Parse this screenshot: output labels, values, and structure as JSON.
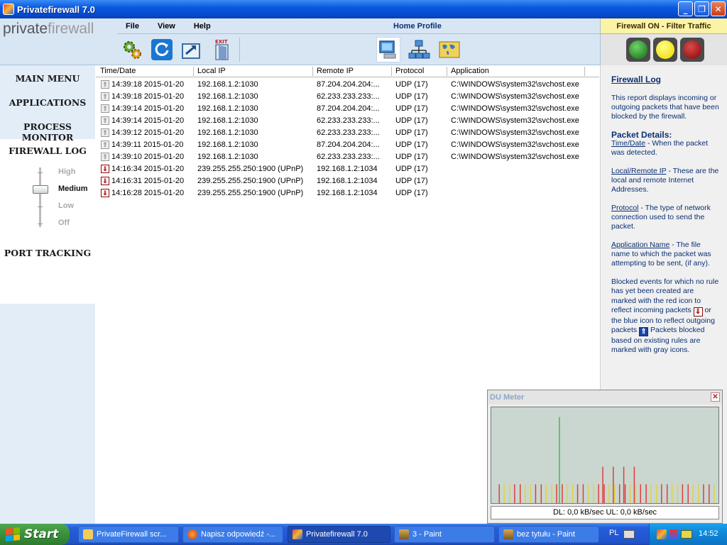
{
  "window": {
    "title": "Privatefirewall 7.0",
    "minimize": "_",
    "maximize": "❐",
    "close": "✕"
  },
  "logo": {
    "part1": "private",
    "part2": "firewall"
  },
  "menu": [
    "File",
    "View",
    "Help"
  ],
  "profile": "Home Profile",
  "status": {
    "label": "Firewall ON - Filter Traffic",
    "colors": {
      "green": "#2c8a2a",
      "yellow": "#f4e51b",
      "red": "#a01818"
    }
  },
  "sidebar": {
    "items": [
      "MAIN MENU",
      "APPLICATIONS",
      "PROCESS MONITOR",
      "FIREWALL LOG",
      "PORT TRACKING"
    ],
    "levels": [
      "High",
      "Medium",
      "Low",
      "Off"
    ],
    "selected_level": "Medium"
  },
  "log": {
    "columns": [
      "Time/Date",
      "Local IP",
      "Remote IP",
      "Protocol",
      "Application"
    ],
    "rows": [
      {
        "type": "gray",
        "time": "14:39:18  2015-01-20",
        "local": "192.168.1.2:1030",
        "remote": "87.204.204.204:...",
        "protocol": "UDP (17)",
        "app": "C:\\WINDOWS\\system32\\svchost.exe"
      },
      {
        "type": "gray",
        "time": "14:39:18  2015-01-20",
        "local": "192.168.1.2:1030",
        "remote": "62.233.233.233:...",
        "protocol": "UDP (17)",
        "app": "C:\\WINDOWS\\system32\\svchost.exe"
      },
      {
        "type": "gray",
        "time": "14:39:14  2015-01-20",
        "local": "192.168.1.2:1030",
        "remote": "87.204.204.204:...",
        "protocol": "UDP (17)",
        "app": "C:\\WINDOWS\\system32\\svchost.exe"
      },
      {
        "type": "gray",
        "time": "14:39:14  2015-01-20",
        "local": "192.168.1.2:1030",
        "remote": "62.233.233.233:...",
        "protocol": "UDP (17)",
        "app": "C:\\WINDOWS\\system32\\svchost.exe"
      },
      {
        "type": "gray",
        "time": "14:39:12  2015-01-20",
        "local": "192.168.1.2:1030",
        "remote": "62.233.233.233:...",
        "protocol": "UDP (17)",
        "app": "C:\\WINDOWS\\system32\\svchost.exe"
      },
      {
        "type": "gray",
        "time": "14:39:11  2015-01-20",
        "local": "192.168.1.2:1030",
        "remote": "87.204.204.204:...",
        "protocol": "UDP (17)",
        "app": "C:\\WINDOWS\\system32\\svchost.exe"
      },
      {
        "type": "gray",
        "time": "14:39:10  2015-01-20",
        "local": "192.168.1.2:1030",
        "remote": "62.233.233.233:...",
        "protocol": "UDP (17)",
        "app": "C:\\WINDOWS\\system32\\svchost.exe"
      },
      {
        "type": "red",
        "time": "14:16:34  2015-01-20",
        "local": "239.255.255.250:1900 (UPnP)",
        "remote": "192.168.1.2:1034",
        "protocol": "UDP (17)",
        "app": ""
      },
      {
        "type": "red",
        "time": "14:16:31  2015-01-20",
        "local": "239.255.255.250:1900 (UPnP)",
        "remote": "192.168.1.2:1034",
        "protocol": "UDP (17)",
        "app": ""
      },
      {
        "type": "red",
        "time": "14:16:28  2015-01-20",
        "local": "239.255.255.250:1900 (UPnP)",
        "remote": "192.168.1.2:1034",
        "protocol": "UDP (17)",
        "app": ""
      }
    ]
  },
  "info": {
    "title": "Firewall Log",
    "intro": "This report displays incoming or outgoing packets that have been blocked by the firewall.",
    "details_title": "Packet Details:",
    "timedate_term": "Time/Date",
    "timedate_text": " - When the packet was detected.",
    "ip_term": "Local/Remote IP",
    "ip_text": " - These are the local and remote Internet Addresses.",
    "protocol_term": "Protocol",
    "protocol_text": " - The type of network connection used to send the packet.",
    "app_term": "Application Name",
    "app_text": " - The file name to which the packet was attempting to be sent, (if any).",
    "blocked_1": "Blocked events for which no rule has yet been created are marked with the red icon to reflect incoming packets",
    "blocked_2": " or the blue icon to reflect outgoing packets",
    "blocked_3": " Packets blocked based on existing rules are marked with gray icons."
  },
  "du_meter": {
    "title": "DU Meter",
    "readout": "DL: 0,0 kB/sec  UL: 0,0 kB/sec"
  },
  "taskbar": {
    "start": "Start",
    "tasks": [
      "PrivateFirewall scr...",
      "Napisz odpowiedź -...",
      "Privatefirewall 7.0",
      "3 - Paint",
      "bez tytułu - Paint"
    ],
    "lang": "PL",
    "clock": "14:52"
  }
}
